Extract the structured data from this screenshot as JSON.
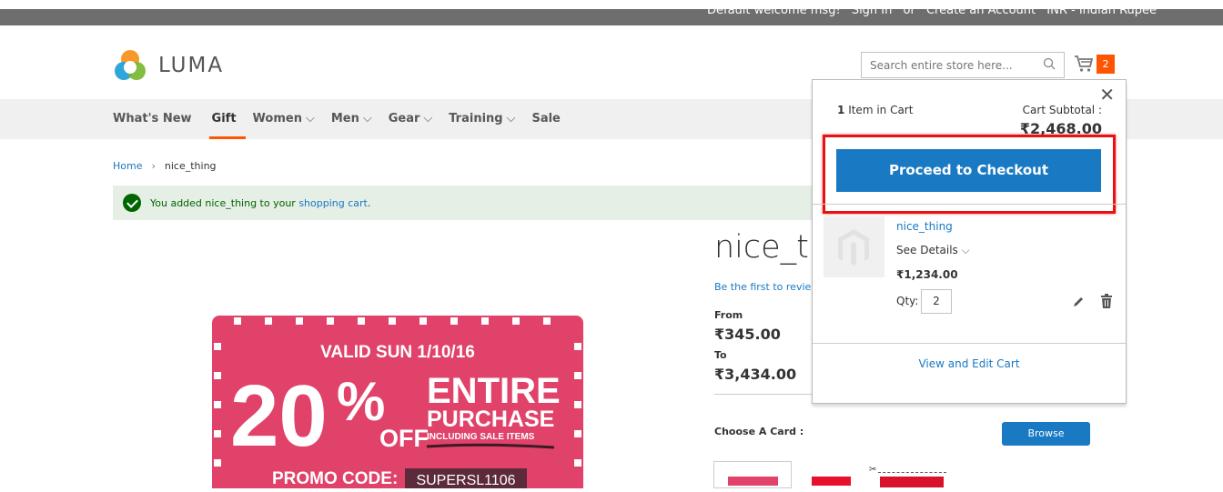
{
  "topbar": {
    "welcome": "Default welcome msg!",
    "sign_in": "Sign In",
    "or": "or",
    "create_account": "Create an Account",
    "currency": "INR - Indian Rupee"
  },
  "header": {
    "logo_text": "LUMA",
    "search_placeholder": "Search entire store here...",
    "cart_count": "2"
  },
  "nav": {
    "items": [
      {
        "label": "What's New"
      },
      {
        "label": "Gift"
      },
      {
        "label": "Women"
      },
      {
        "label": "Men"
      },
      {
        "label": "Gear"
      },
      {
        "label": "Training"
      },
      {
        "label": "Sale"
      }
    ]
  },
  "breadcrumb": {
    "home": "Home",
    "current": "nice_thing"
  },
  "message": {
    "text": "You added nice_thing to your",
    "link": "shopping cart",
    "end": "."
  },
  "product": {
    "title": "nice_thing",
    "review_link": "Be the first to review this product",
    "from_label": "From",
    "from_price": "₹345.00",
    "to_label": "To",
    "to_price": "₹3,434.00",
    "choose_card_label": "Choose A Card :",
    "browse_label": "Browse"
  },
  "coupon": {
    "valid": "VALID SUN 1/10/16",
    "percent": "20",
    "off": "OFF",
    "entire": "ENTIRE",
    "purchase": "PURCHASE",
    "including": "INCLUDING SALE ITEMS",
    "promo_label": "PROMO CODE:",
    "promo_code": "SUPERSL1106"
  },
  "minicart": {
    "count": "1",
    "count_label": "Item in Cart",
    "subtotal_label": "Cart Subtotal :",
    "subtotal_value": "₹2,468.00",
    "checkout_label": "Proceed to Checkout",
    "item": {
      "name": "nice_thing",
      "details": "See Details",
      "price": "₹1,234.00",
      "qty_label": "Qty:",
      "qty": "2"
    },
    "view_edit": "View and Edit Cart"
  },
  "colors": {
    "accent": "#1979c3",
    "highlight": "#e81010",
    "badge": "#ff5501",
    "coupon": "#e0426a"
  }
}
